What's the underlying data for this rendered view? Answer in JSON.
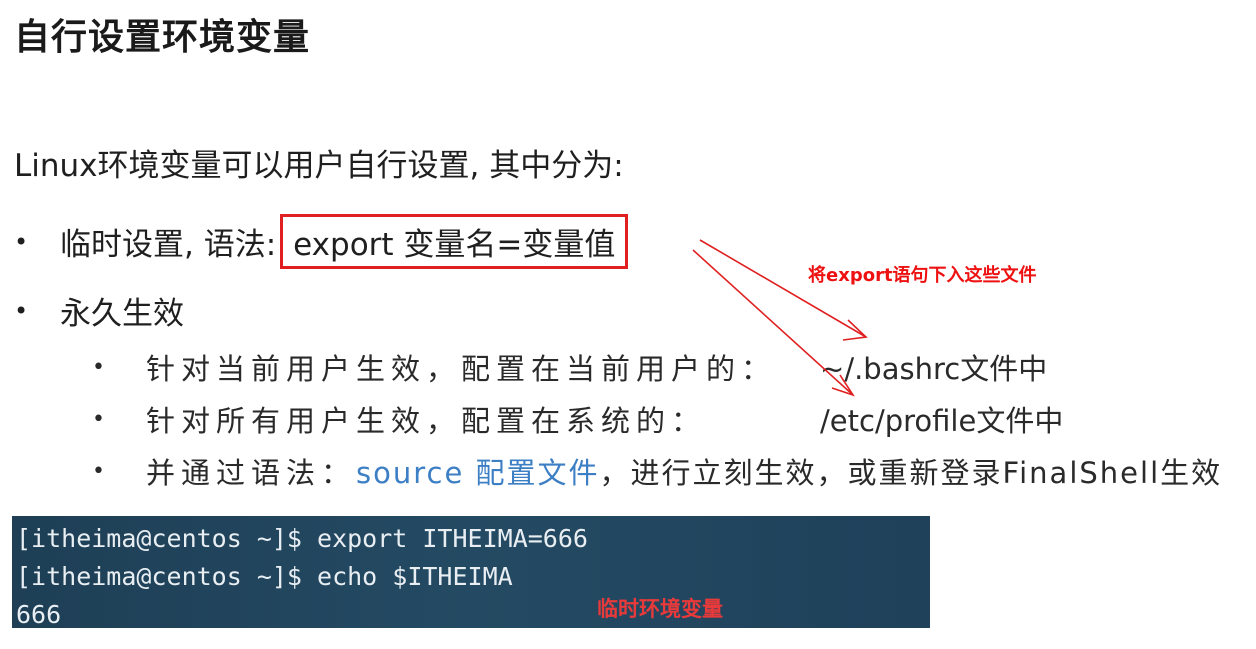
{
  "title": "自行设置环境变量",
  "intro": "Linux环境变量可以用户自行设置, 其中分为:",
  "temp": {
    "label": "临时设置, 语法:",
    "syntax": "export 变量名=变量值"
  },
  "perm": {
    "label": "永久生效"
  },
  "sub_items": [
    {
      "text": "针对当前用户生效，配置在当前用户的：",
      "path": "~/.bashrc文件中"
    },
    {
      "text": "针对所有用户生效，配置在系统的：",
      "path": "/etc/profile文件中"
    },
    {
      "pre": "并通过语法：",
      "source": "source 配置文件",
      "post": "，进行立刻生效，或重新登录FinalShell生效"
    }
  ],
  "annotation": "将export语句下入这些文件",
  "terminal": {
    "lines": [
      "[itheima@centos ~]$ export ITHEIMA=666",
      "[itheima@centos ~]$ echo $ITHEIMA",
      "666"
    ],
    "note": "临时环境变量"
  },
  "colors": {
    "highlight": "#e02020",
    "source_link": "#3d7fc4",
    "terminal_bg": "#224760"
  }
}
